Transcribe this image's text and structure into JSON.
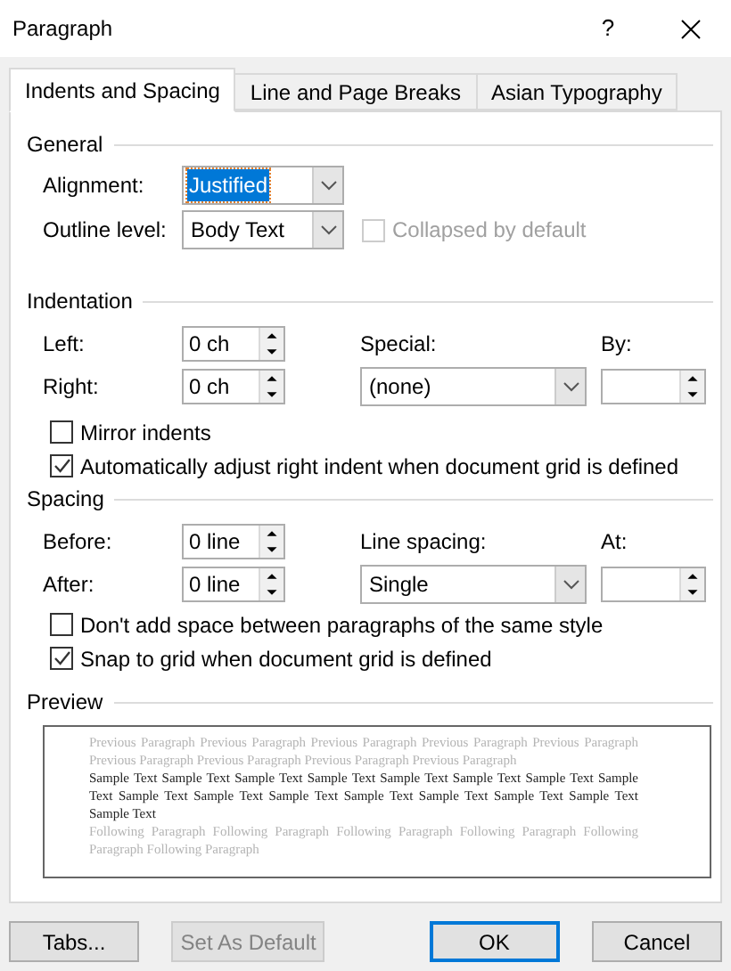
{
  "window": {
    "title": "Paragraph",
    "help": "?"
  },
  "tabs": [
    {
      "label": "Indents and Spacing",
      "selected": true
    },
    {
      "label": "Line and Page Breaks",
      "selected": false
    },
    {
      "label": "Asian Typography",
      "selected": false
    }
  ],
  "general": {
    "heading": "General",
    "alignment": {
      "label": "Alignment:",
      "value": "Justified",
      "focused": true
    },
    "outline_level": {
      "label": "Outline level:",
      "value": "Body Text",
      "focused": false
    },
    "collapsed": {
      "label": "Collapsed by default",
      "checked": false,
      "disabled": true
    }
  },
  "indentation": {
    "heading": "Indentation",
    "left": {
      "label": "Left:",
      "value": "0 ch"
    },
    "right": {
      "label": "Right:",
      "value": "0 ch"
    },
    "special": {
      "label": "Special:",
      "value": "(none)"
    },
    "by": {
      "label": "By:"
    },
    "checkboxes": [
      {
        "label": "Mirror indents",
        "checked": false
      },
      {
        "label": "Automatically adjust right indent when document grid is defined",
        "checked": true
      }
    ]
  },
  "spacing": {
    "heading": "Spacing",
    "before": {
      "label": "Before:",
      "value": "0 line"
    },
    "after": {
      "label": "After:",
      "value": "0 line"
    },
    "line_spacing": {
      "label": "Line spacing:",
      "value": "Single"
    },
    "at": {
      "label": "At:"
    },
    "checkboxes": [
      {
        "label": "Don't add space between paragraphs of the same style",
        "checked": false
      },
      {
        "label": "Snap to grid when document grid is defined",
        "checked": true
      }
    ]
  },
  "preview": {
    "heading": "Preview",
    "previous": "Previous Paragraph Previous Paragraph Previous Paragraph Previous Paragraph Previous Paragraph Previous Paragraph Previous Paragraph Previous Paragraph Previous Paragraph",
    "sample": "Sample Text Sample Text Sample Text Sample Text Sample Text Sample Text Sample Text Sample Text Sample Text Sample Text Sample Text Sample Text Sample Text Sample Text Sample Text Sample Text",
    "following": "Following Paragraph Following Paragraph Following Paragraph Following Paragraph Following Paragraph Following Paragraph"
  },
  "buttons": [
    {
      "label": "Tabs...",
      "disabled": false,
      "default": false
    },
    {
      "label": "Set As Default",
      "disabled": true,
      "default": false
    },
    {
      "label": "OK",
      "disabled": false,
      "default": true
    },
    {
      "label": "Cancel",
      "disabled": false,
      "default": false
    }
  ]
}
